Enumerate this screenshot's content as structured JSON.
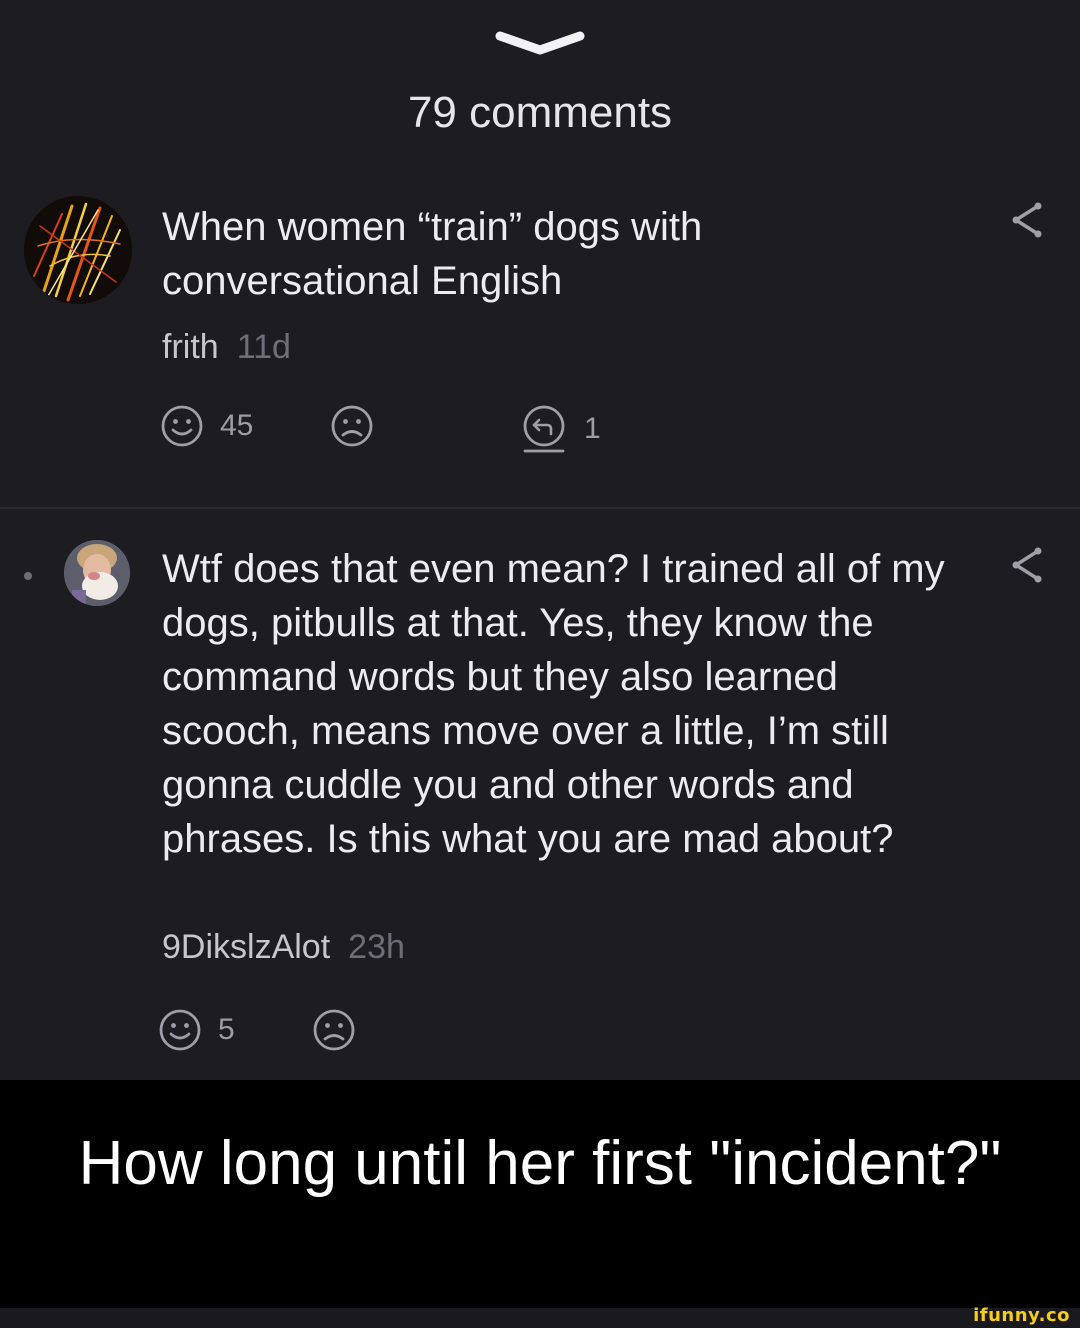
{
  "header": {
    "count_label": "79 comments"
  },
  "comments": [
    {
      "text": "When women “train” dogs with conversational English",
      "user": "frith",
      "time": "11d",
      "smile_count": "45",
      "reply_count": "1"
    },
    {
      "text": "Wtf does that even mean? I trained all of my dogs, pitbulls at that. Yes, they know the command words but they also learned scooch, means move over a little, I’m still gonna cuddle you and other words and phrases. Is this what you are mad about?",
      "user": "9DikslzAlot",
      "time": "23h",
      "smile_count": "5"
    }
  ],
  "caption": {
    "text": "How long until her first \"incident?\""
  },
  "watermark": {
    "text": "ifunny.co"
  },
  "colors": {
    "background": "#1c1c21",
    "text": "#ecebf0",
    "muted": "#6f6e78",
    "icon": "#a09fa8",
    "watermark": "#f4ce1a"
  },
  "icons": {
    "collapse": "chevron-down-icon",
    "share": "share-icon",
    "like": "smile-icon",
    "dislike": "sad-icon",
    "reply": "reply-icon"
  }
}
